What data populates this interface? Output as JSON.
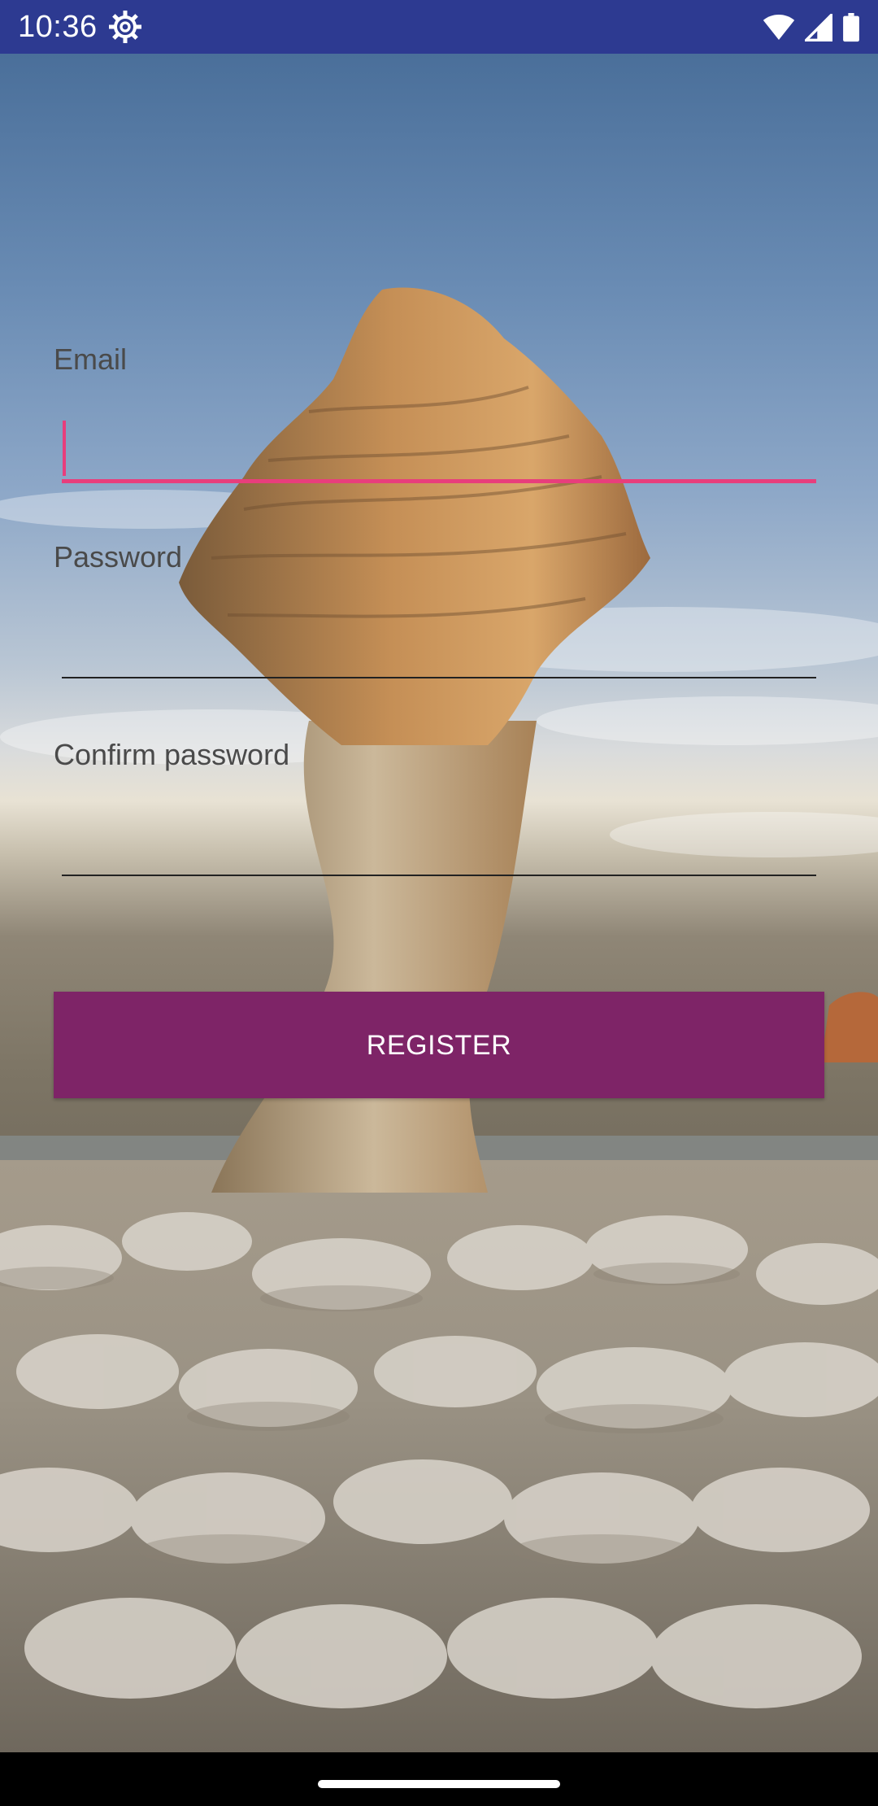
{
  "status_bar": {
    "time": "10:36",
    "settings_icon": "gear-icon",
    "wifi_icon": "wifi-icon",
    "signal_icon": "cell-signal-icon",
    "battery_icon": "battery-icon",
    "background_color": "#2d3a91"
  },
  "form": {
    "email": {
      "label": "Email",
      "value": "",
      "focused": true
    },
    "password": {
      "label": "Password",
      "value": ""
    },
    "confirm_password": {
      "label": "Confirm password",
      "value": ""
    },
    "register_button": {
      "label": "REGISTER",
      "color": "#7e2467"
    },
    "accent_color": "#e83e7c"
  },
  "background": {
    "description_icon": "rock-landscape-image"
  }
}
